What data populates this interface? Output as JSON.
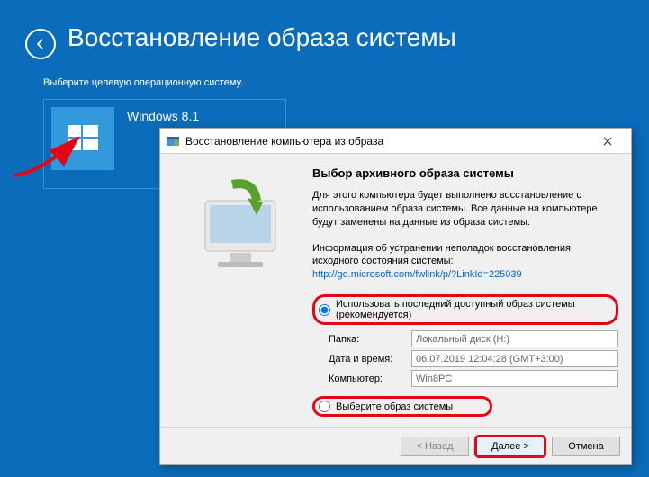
{
  "page": {
    "title": "Восстановление образа системы",
    "subtitle": "Выберите целевую операционную систему."
  },
  "os_tile": {
    "name": "Windows 8.1"
  },
  "dialog": {
    "title": "Восстановление компьютера из образа",
    "heading": "Выбор архивного образа системы",
    "description": "Для этого компьютера будет выполнено восстановление с использованием образа системы. Все данные на компьютере будут заменены на данные из образа системы.",
    "info_text": "Информация об устранении неполадок восстановления исходного состояния системы:",
    "info_link": "http://go.microsoft.com/fwlink/p/?LinkId=225039",
    "radio_recommended": "Использовать последний доступный образ системы (рекомендуется)",
    "radio_select": "Выберите образ системы",
    "fields": {
      "folder_label": "Папка:",
      "folder_value": "Локальный диск (H:)",
      "date_label": "Дата и время:",
      "date_value": "06.07.2019 12:04:28 (GMT+3:00)",
      "computer_label": "Компьютер:",
      "computer_value": "Win8PC"
    },
    "buttons": {
      "back": "< Назад",
      "next": "Далее >",
      "cancel": "Отмена"
    }
  }
}
